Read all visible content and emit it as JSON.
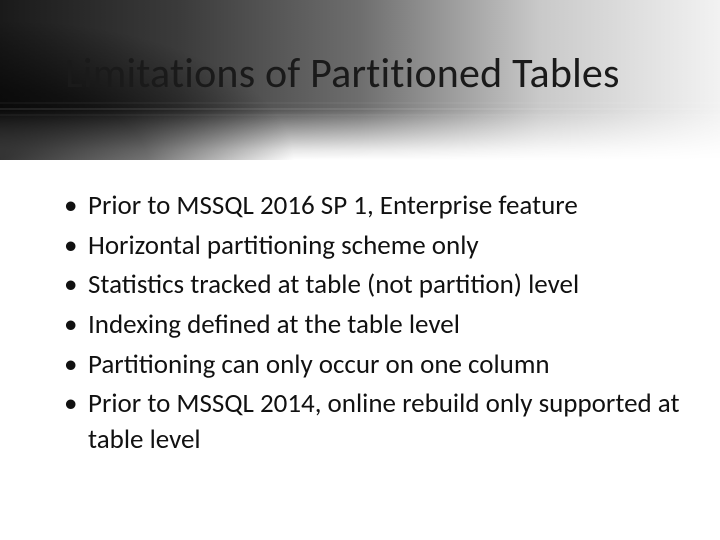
{
  "title": "Limitations of Partitioned Tables",
  "bullets": [
    "Prior to MSSQL 2016 SP 1, Enterprise feature",
    "Horizontal partitioning scheme only",
    "Statistics tracked at table (not partition) level",
    "Indexing defined at the table level",
    "Partitioning can only occur on one column",
    "Prior to MSSQL 2014, online rebuild only supported at table level"
  ]
}
